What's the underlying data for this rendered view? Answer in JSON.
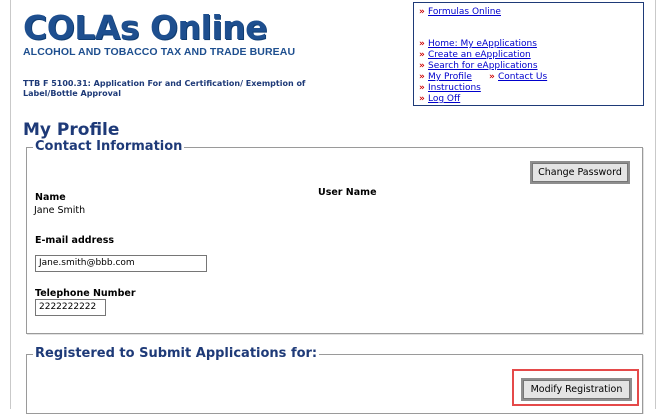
{
  "header": {
    "logo_title": "COLAs Online",
    "logo_subtitle": "ALCOHOL AND TOBACCO TAX AND TRADE BUREAU",
    "form_description": "TTB F 5100.31: Application For and Certification/ Exemption of Label/Bottle Approval"
  },
  "nav": {
    "formulas_online": "Formulas Online",
    "home": "Home: My eApplications",
    "create": "Create an eApplication",
    "search": "Search for eApplications",
    "my_profile": "My Profile",
    "contact_us": "Contact Us",
    "instructions": "Instructions",
    "log_off": "Log Off",
    "arrow_icon": "red-double-chevron"
  },
  "page": {
    "title": "My Profile"
  },
  "contact": {
    "legend": "Contact Information",
    "change_password_label": "Change Password",
    "name_label": "Name",
    "name_value": "Jane Smith",
    "username_label": "User Name",
    "email_label": "E-mail address",
    "email_value": "Jane.smith@bbb.com",
    "phone_label": "Telephone Number",
    "phone_value": "2222222222"
  },
  "registered": {
    "legend": "Registered to Submit Applications for:",
    "modify_label": "Modify Registration"
  },
  "colors": {
    "brand_blue": "#1e4f8f",
    "heading_navy": "#1e3a78",
    "link_blue": "#0000cc",
    "arrow_red": "#cc0000",
    "highlight_red": "#e54a4a"
  }
}
